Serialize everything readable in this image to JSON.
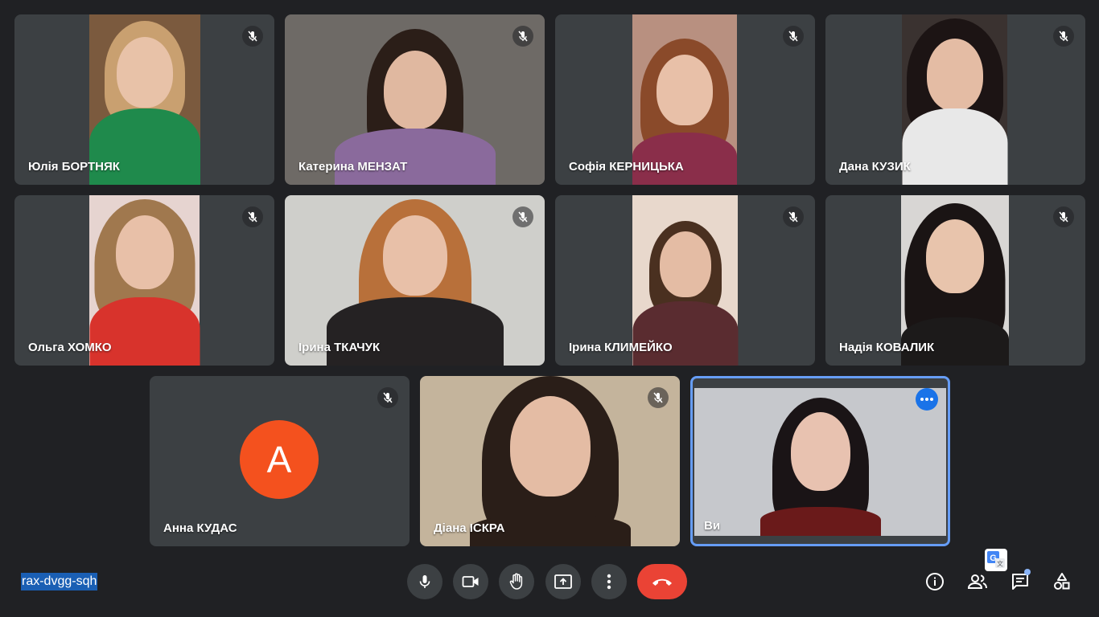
{
  "participants": [
    {
      "name": "Юлія БОРТНЯК"
    },
    {
      "name": "Катерина МЕНЗАТ"
    },
    {
      "name": "Софія КЕРНИЦЬКА"
    },
    {
      "name": "Дана КУЗИК"
    },
    {
      "name": "Ольга ХОМКО"
    },
    {
      "name": "Ірина ТКАЧУК"
    },
    {
      "name": "Ірина КЛИМЕЙКО"
    },
    {
      "name": "Надія КОВАЛИК"
    },
    {
      "name": "Анна КУДАС",
      "avatar_letter": "A",
      "avatar_color": "#f4511e"
    },
    {
      "name": "Діана ІСКРА"
    },
    {
      "name": "Ви"
    }
  ],
  "meeting_code": "rax-dvgg-sqh",
  "controls": {
    "microphone": "mic-icon",
    "camera": "camera-icon",
    "raise_hand": "hand-icon",
    "present": "present-screen-icon",
    "more": "more-vert-icon",
    "end_call": "end-call-icon"
  },
  "right_controls": [
    "info-icon",
    "people-icon",
    "chat-icon",
    "activities-icon"
  ],
  "colors": {
    "background": "#202124",
    "tile": "#3c4043",
    "end_call": "#ea4335",
    "self_border": "#669df6",
    "accent": "#1a73e8"
  }
}
